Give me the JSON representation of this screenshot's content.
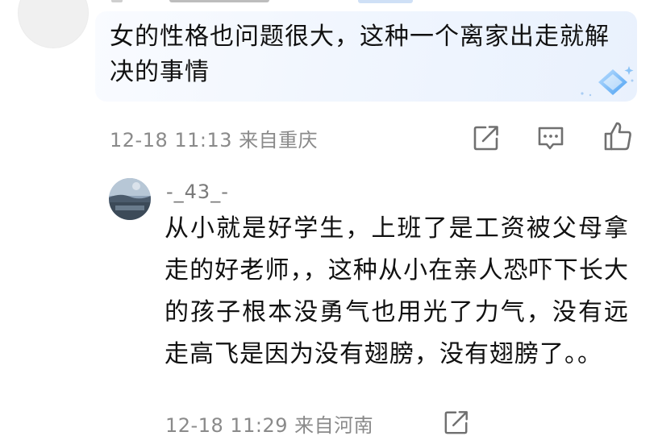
{
  "top_comment": {
    "text": "女的性格也问题很大，这种一个离家出走就解决的事情",
    "timestamp": "12-18 11:13",
    "location": "来自重庆",
    "actions": {
      "share_icon": "share-icon",
      "comment_icon": "comment-icon",
      "like_icon": "thumbs-up-icon"
    },
    "decoration_icon": "diamond-sparkle-icon",
    "bubble_color": "#eef4fd"
  },
  "reply": {
    "username": "-_43_-",
    "text": "从小就是好学生，上班了是工资被父母拿走的好老师，，这种从小在亲人恐吓下长大的孩子根本没勇气也用光了力气，没有远走高飞是因为没有翅膀，没有翅膀了。。",
    "timestamp": "12-18 11:29",
    "location": "来自河南",
    "actions": {
      "share_icon": "share-icon"
    }
  },
  "colors": {
    "text": "#111111",
    "meta": "#8a8a8a",
    "icon": "#707070"
  }
}
